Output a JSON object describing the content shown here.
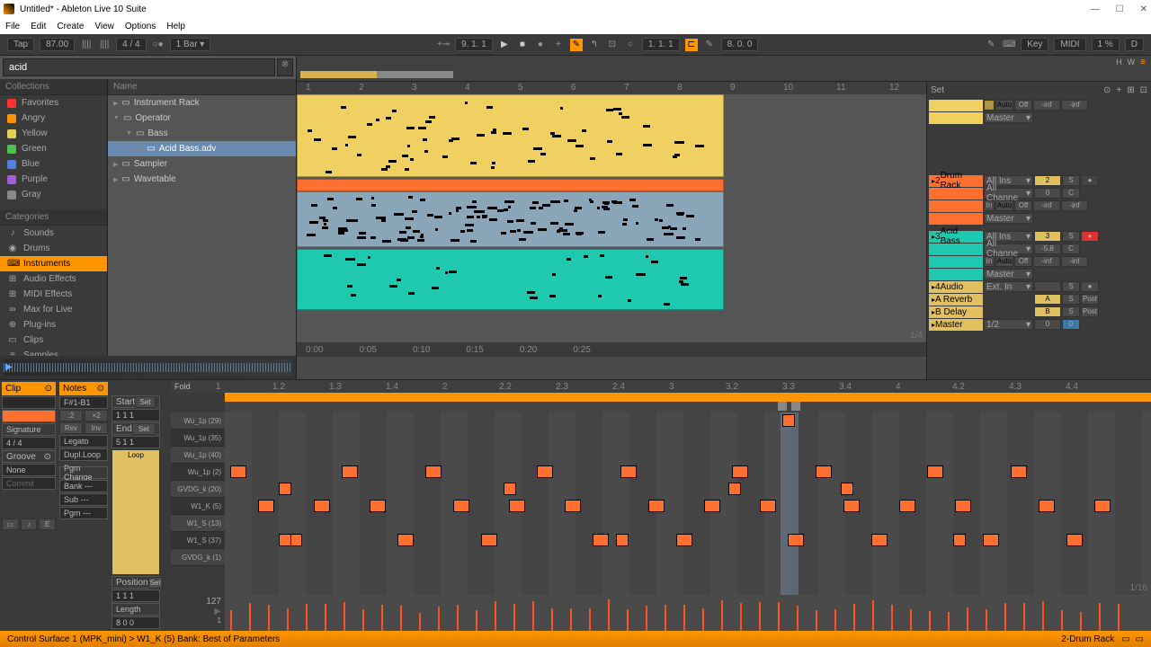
{
  "title": "Untitled* - Ableton Live 10 Suite",
  "menus": [
    "File",
    "Edit",
    "Create",
    "View",
    "Options",
    "Help"
  ],
  "topbar": {
    "tap": "Tap",
    "bpm": "87.00",
    "sig": "4 / 4",
    "metro": "1 Bar",
    "position": "9.  1.  1",
    "loop_pos": "1.  1.  1",
    "loop_len": "8.  0.  0",
    "key": "Key",
    "midi": "MIDI",
    "cpu": "1 %",
    "disk": "D"
  },
  "search": {
    "placeholder": "",
    "value": "acid"
  },
  "collections_hdr": "Collections",
  "collections": [
    {
      "name": "Favorites",
      "color": "#ff3030"
    },
    {
      "name": "Angry",
      "color": "#ff9500"
    },
    {
      "name": "Yellow",
      "color": "#e8d050"
    },
    {
      "name": "Green",
      "color": "#50c050"
    },
    {
      "name": "Blue",
      "color": "#5080e0"
    },
    {
      "name": "Purple",
      "color": "#a060d0"
    },
    {
      "name": "Gray",
      "color": "#888"
    }
  ],
  "categories_hdr": "Categories",
  "categories": [
    {
      "icon": "♪",
      "name": "Sounds"
    },
    {
      "icon": "◉",
      "name": "Drums"
    },
    {
      "icon": "⌨",
      "name": "Instruments"
    },
    {
      "icon": "⊞",
      "name": "Audio Effects"
    },
    {
      "icon": "⊞",
      "name": "MIDI Effects"
    },
    {
      "icon": "∞",
      "name": "Max for Live"
    },
    {
      "icon": "⊕",
      "name": "Plug-ins"
    },
    {
      "icon": "▭",
      "name": "Clips"
    },
    {
      "icon": "≡",
      "name": "Samples"
    },
    {
      "icon": "⌕",
      "name": "All results"
    }
  ],
  "name_hdr": "Name",
  "tree": [
    {
      "label": "Instrument Rack",
      "indent": 0,
      "exp": false
    },
    {
      "label": "Operator",
      "indent": 0,
      "exp": true
    },
    {
      "label": "Bass",
      "indent": 1,
      "exp": true
    },
    {
      "label": "Acid Bass.adv",
      "indent": 2,
      "exp": false,
      "sel": true
    },
    {
      "label": "Sampler",
      "indent": 0,
      "exp": false
    },
    {
      "label": "Wavetable",
      "indent": 0,
      "exp": false
    }
  ],
  "ruler_bars": [
    "1",
    "2",
    "3",
    "4",
    "5",
    "6",
    "7",
    "8",
    "9",
    "10",
    "11",
    "12"
  ],
  "timeline": [
    "0:00",
    "0:05",
    "0:10",
    "0:15",
    "0:20",
    "0:25"
  ],
  "set_label": "Set",
  "tracks": [
    {
      "n": "2",
      "name": "Drum Rack",
      "color": "#ff7030"
    },
    {
      "n": "3",
      "name": "Acid Bass",
      "color": "#1fc9b0"
    },
    {
      "n": "4",
      "name": "Audio",
      "color": "#e0c060"
    }
  ],
  "sends": [
    {
      "label": "A Reverb",
      "btn": "A"
    },
    {
      "label": "B Delay",
      "btn": "B"
    }
  ],
  "master_label": "Master",
  "routing": {
    "all_ins": "All Ins",
    "all_ch": "All Channe",
    "in": "In",
    "auto": "Auto",
    "off": "Off",
    "master": "Master",
    "ext_in": "Ext. In",
    "inf": "-inf",
    "none": "---",
    "half": "1/2"
  },
  "mixer_vals": {
    "t2_vol": "2",
    "t2_pan": "0",
    "t3_vol": "3",
    "t3_pan": "-5.8",
    "s": "S",
    "c": "C",
    "post": "Post"
  },
  "clip_panel": {
    "clip_hdr": "Clip",
    "notes_hdr": "Notes",
    "fold": "Fold",
    "range": "F#1-B1",
    "start": "Start",
    "end": "End",
    "loop": "Loop",
    "pos": "Position",
    "len": "Length",
    "sig_lbl": "Signature",
    "sig_val": "4     /     4",
    "groove": "Groove",
    "none": "None",
    "commit": "Commit",
    "rev": "Rev",
    "inv": "Inv",
    "legato": "Legato",
    "dupl": "Dupl.Loop",
    "pgm": "Pgm Change",
    "bank": "Bank ---",
    "sub": "Sub ---",
    "pgm2": "Pgm ---",
    "x2": "×2",
    ":2": ":2",
    "pos_111": "1   1   1",
    "len_511": "5   1   1",
    "len_811": "8   0   0",
    "set": "Set"
  },
  "piano_keys": [
    "Wu_1p (29)",
    "Wu_1p (35)",
    "Wu_1p (40)",
    "Wu_1p (2)",
    "GVDG_k (20)",
    "W1_K (5)",
    "W1_S (13)",
    "W1_S (37)",
    "GVDG_k (1)"
  ],
  "pr_bars": [
    "1",
    "1.2",
    "1.3",
    "1.4",
    "2",
    "2.2",
    "2.3",
    "2.4",
    "3",
    "3.2",
    "3.3",
    "3.4",
    "4",
    "4.2",
    "4.3",
    "4.4"
  ],
  "vel_label": "127",
  "frac_arr": "1/4",
  "frac_pr": "1/16",
  "status": "Control Surface 1 (MPK_mini) > W1_K (5) Bank: Best of Parameters",
  "status_right": "2-Drum Rack"
}
